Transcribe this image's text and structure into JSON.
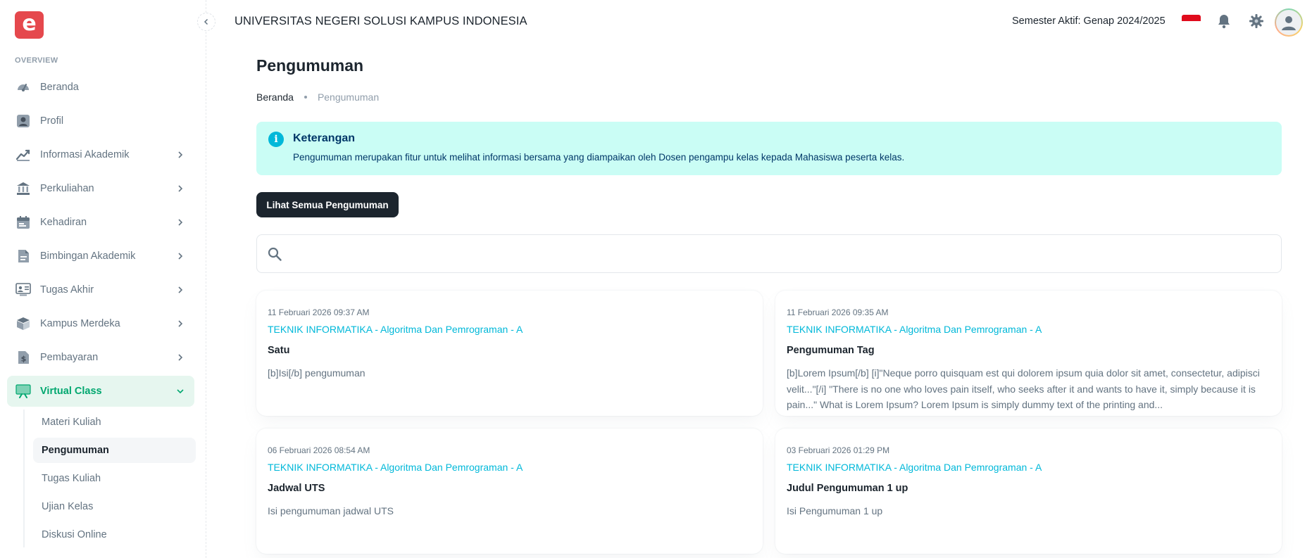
{
  "sidebar": {
    "logo_letter": "e",
    "section_label": "OVERVIEW",
    "items": [
      {
        "label": "Beranda",
        "icon": "dashboard-icon",
        "has_children": false
      },
      {
        "label": "Profil",
        "icon": "user-icon",
        "has_children": false
      },
      {
        "label": "Informasi Akademik",
        "icon": "chart-line-icon",
        "has_children": true
      },
      {
        "label": "Perkuliahan",
        "icon": "building-icon",
        "has_children": true
      },
      {
        "label": "Kehadiran",
        "icon": "calendar-icon",
        "has_children": true
      },
      {
        "label": "Bimbingan Akademik",
        "icon": "document-icon",
        "has_children": true
      },
      {
        "label": "Tugas Akhir",
        "icon": "presentation-icon",
        "has_children": true
      },
      {
        "label": "Kampus Merdeka",
        "icon": "box-icon",
        "has_children": true
      },
      {
        "label": "Pembayaran",
        "icon": "dollar-icon",
        "has_children": true
      },
      {
        "label": "Virtual Class",
        "icon": "easel-icon",
        "has_children": true,
        "active": true
      }
    ],
    "virtual_class_children": [
      {
        "label": "Materi Kuliah"
      },
      {
        "label": "Pengumuman",
        "active": true
      },
      {
        "label": "Tugas Kuliah"
      },
      {
        "label": "Ujian Kelas"
      },
      {
        "label": "Diskusi Online"
      }
    ]
  },
  "header": {
    "title": "UNIVERSITAS NEGERI SOLUSI KAMPUS INDONESIA",
    "semester": "Semester Aktif: Genap 2024/2025"
  },
  "main": {
    "page_title": "Pengumuman",
    "breadcrumb": {
      "home": "Beranda",
      "current": "Pengumuman"
    },
    "alert": {
      "title": "Keterangan",
      "text": "Pengumuman merupakan fitur untuk melihat informasi bersama yang diampaikan oleh Dosen pengampu kelas kepada Mahasiswa peserta kelas."
    },
    "view_all_label": "Lihat Semua Pengumuman",
    "search": {
      "value": "",
      "placeholder": ""
    },
    "announcements": [
      {
        "date": "11 Februari 2026 09:37 AM",
        "course": "TEKNIK INFORMATIKA - Algoritma Dan Pemrograman - A",
        "title": "Satu",
        "body": "[b]Isi[/b] pengumuman"
      },
      {
        "date": "11 Februari 2026 09:35 AM",
        "course": "TEKNIK INFORMATIKA - Algoritma Dan Pemrograman - A",
        "title": "Pengumuman Tag",
        "body": "[b]Lorem Ipsum[/b] [i]\"Neque porro quisquam est qui dolorem ipsum quia dolor sit amet, consectetur, adipisci velit...\"[/i] \"There is no one who loves pain itself, who seeks after it and wants to have it, simply because it is pain...\" What is Lorem Ipsum? Lorem Ipsum is simply dummy text of the printing and..."
      },
      {
        "date": "06 Februari 2026 08:54 AM",
        "course": "TEKNIK INFORMATIKA - Algoritma Dan Pemrograman - A",
        "title": "Jadwal UTS",
        "body": "Isi pengumuman jadwal UTS"
      },
      {
        "date": "03 Februari 2026 01:29 PM",
        "course": "TEKNIK INFORMATIKA - Algoritma Dan Pemrograman - A",
        "title": "Judul Pengumuman 1 up",
        "body": "Isi Pengumuman 1 up"
      }
    ]
  },
  "colors": {
    "brand": "#e5484d",
    "active": "#00a76f",
    "info": "#00b8d9",
    "alert_bg": "#cafdf5",
    "dark_button": "#1c252e"
  }
}
